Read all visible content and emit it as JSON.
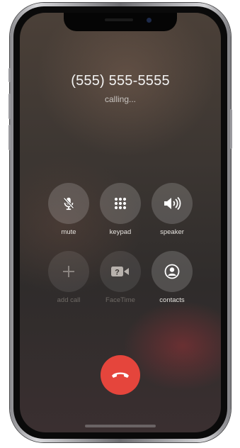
{
  "call": {
    "number": "(555) 555-5555",
    "status": "calling..."
  },
  "controls": {
    "mute": {
      "label": "mute",
      "icon": "microphone-slash-icon",
      "enabled": true
    },
    "keypad": {
      "label": "keypad",
      "icon": "keypad-grid-icon",
      "enabled": true
    },
    "speaker": {
      "label": "speaker",
      "icon": "speaker-wave-icon",
      "enabled": true
    },
    "add_call": {
      "label": "add call",
      "icon": "plus-icon",
      "enabled": false
    },
    "facetime": {
      "label": "FaceTime",
      "icon": "facetime-camera-icon",
      "enabled": false
    },
    "contacts": {
      "label": "contacts",
      "icon": "person-circle-icon",
      "enabled": true
    }
  },
  "end_call": {
    "icon": "phone-hangup-icon",
    "color": "#e5453c"
  }
}
